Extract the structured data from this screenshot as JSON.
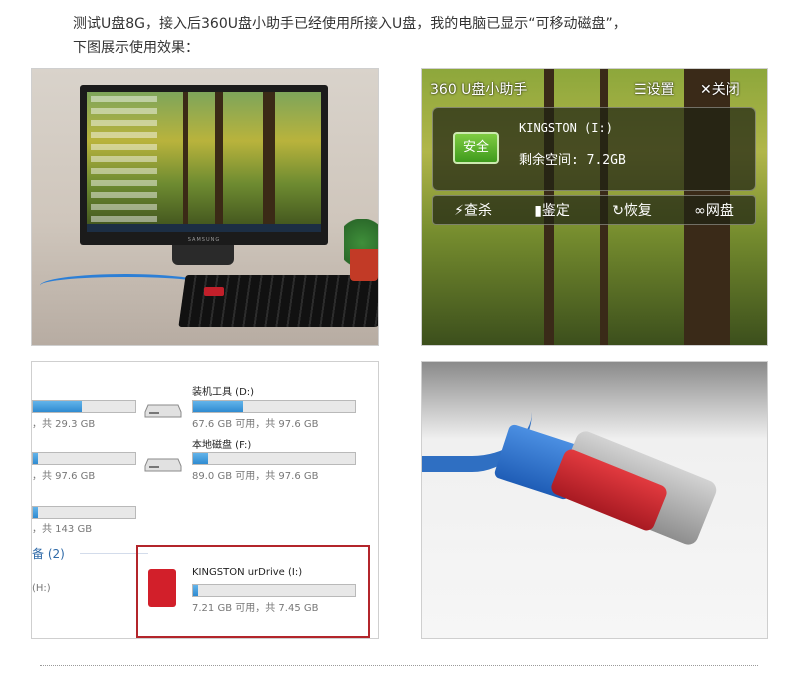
{
  "intro": {
    "line1": "测试U盘8G，接入后360U盘小助手已经使用所接入U盘，我的电脑已显示“可移动磁盘”，",
    "line2": "下图展示使用效果："
  },
  "desk_photo": {
    "monitor_brand": "SAMSUNG"
  },
  "assistant": {
    "title": "360 U盘小助手",
    "settings_label": "☰设置",
    "close_label": "✕关闭",
    "status_badge": "安全",
    "drive_name": "KINGSTON (I:)",
    "free_space": "剩余空间: 7.2GB",
    "actions": [
      {
        "label": "⚡查杀",
        "icon": "lightning-icon"
      },
      {
        "label": "▮鉴定",
        "icon": "usb-drive-icon"
      },
      {
        "label": "↻恢复",
        "icon": "restore-icon"
      },
      {
        "label": "∞网盘",
        "icon": "cloud-link-icon"
      }
    ]
  },
  "explorer": {
    "left_drives": [
      {
        "size": "，共 29.3 GB",
        "fill": 0.48
      },
      {
        "size": "，共 97.6 GB",
        "fill": 0.05
      },
      {
        "size": "，共 143 GB",
        "fill": 0.05
      }
    ],
    "right_drives": [
      {
        "name": "装机工具 (D:)",
        "size": "67.6 GB 可用，共 97.6 GB",
        "fill": 0.31
      },
      {
        "name": "本地磁盘 (F:)",
        "size": "89.0 GB 可用，共 97.6 GB",
        "fill": 0.09
      }
    ],
    "section_label": "备 (2)",
    "left_drive_label": "(H:)",
    "usb_drive": {
      "name": "KINGSTON urDrive (I:)",
      "size": "7.21 GB 可用，共 7.45 GB",
      "fill": 0.03
    }
  },
  "colors": {
    "highlight": "#b3252b",
    "bar_fill": "#2f8bd1",
    "safe_badge": "#5cb130"
  }
}
